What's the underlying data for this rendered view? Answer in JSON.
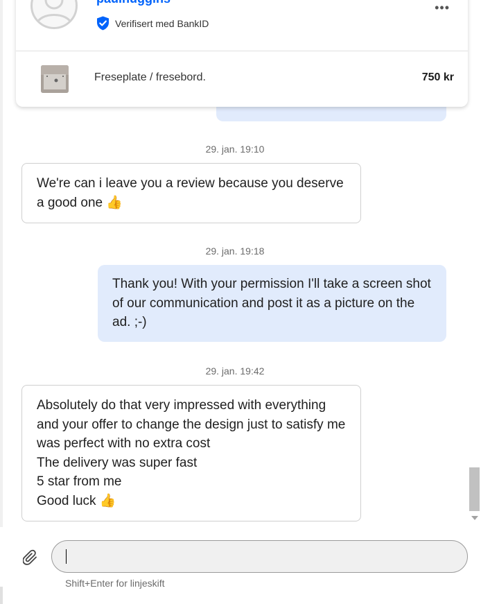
{
  "header": {
    "username": "paulhuggins",
    "verified_text": "Verifisert med BankID",
    "more_label": "•••"
  },
  "listing": {
    "title": "Freseplate / fresebord.",
    "price": "750 kr"
  },
  "messages": [
    {
      "timestamp": "29. jan. 19:10",
      "direction": "incoming",
      "text": "We're can i leave you a review because you deserve a good one 👍"
    },
    {
      "timestamp": "29. jan. 19:18",
      "direction": "outgoing",
      "text": "Thank you! With your permission I'll take a screen shot of our communication and post it as a picture on the ad. ;-)"
    },
    {
      "timestamp": "29. jan. 19:42",
      "direction": "incoming",
      "text": "Absolutely do that very impressed with everything and your offer to change the design just to satisfy me was perfect with no extra cost\nThe delivery was super fast\n5 star from me\nGood luck 👍"
    }
  ],
  "compose": {
    "value": "",
    "hint": "Shift+Enter for linjeskift"
  },
  "colors": {
    "accent": "#0063fb",
    "outgoing_bubble": "#e1ebfc",
    "verified_badge": "#0063fb"
  }
}
